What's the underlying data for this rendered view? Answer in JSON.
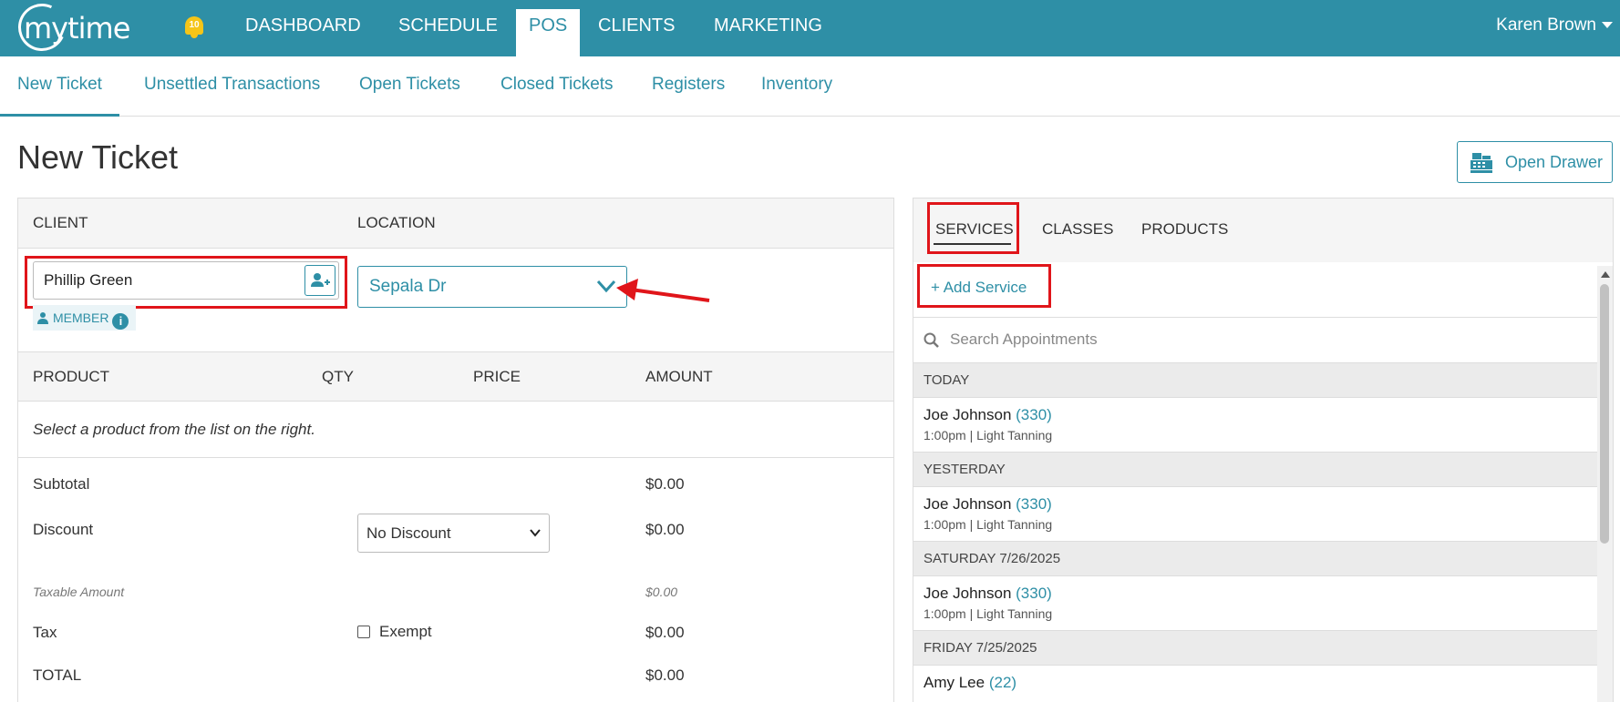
{
  "app": {
    "logo_text": "mytime",
    "notifications_count": "10",
    "user_name": "Karen Brown"
  },
  "nav": {
    "items": [
      {
        "label": "DASHBOARD"
      },
      {
        "label": "SCHEDULE"
      },
      {
        "label": "POS"
      },
      {
        "label": "CLIENTS"
      },
      {
        "label": "MARKETING"
      }
    ],
    "active": "POS"
  },
  "subnav": {
    "items": [
      {
        "label": "New Ticket"
      },
      {
        "label": "Unsettled Transactions"
      },
      {
        "label": "Open Tickets"
      },
      {
        "label": "Closed Tickets"
      },
      {
        "label": "Registers"
      },
      {
        "label": "Inventory"
      }
    ],
    "active": "New Ticket"
  },
  "page": {
    "title": "New Ticket",
    "open_drawer_label": "Open Drawer"
  },
  "ticket": {
    "headers": {
      "client": "CLIENT",
      "location": "LOCATION"
    },
    "client_value": "Phillip Green",
    "member_label": "MEMBER",
    "location_value": "Sepala Dr",
    "columns": {
      "product": "PRODUCT",
      "qty": "QTY",
      "price": "PRICE",
      "amount": "AMOUNT"
    },
    "empty_message": "Select a product from the list on the right.",
    "subtotal_label": "Subtotal",
    "subtotal_value": "$0.00",
    "discount_label": "Discount",
    "discount_option": "No Discount",
    "discount_value": "$0.00",
    "taxable_label": "Taxable Amount",
    "taxable_value": "$0.00",
    "tax_label": "Tax",
    "exempt_label": "Exempt",
    "tax_value": "$0.00",
    "total_label": "TOTAL",
    "total_value": "$0.00"
  },
  "catalog": {
    "tabs": [
      {
        "label": "SERVICES"
      },
      {
        "label": "CLASSES"
      },
      {
        "label": "PRODUCTS"
      }
    ],
    "active_tab": "SERVICES",
    "add_service_label": "+ Add Service",
    "search_placeholder": "Search Appointments",
    "groups": [
      {
        "header": "TODAY",
        "items": [
          {
            "name": "Joe Johnson",
            "code": "(330)",
            "detail": "1:00pm | Light Tanning"
          }
        ]
      },
      {
        "header": "YESTERDAY",
        "items": [
          {
            "name": "Joe Johnson",
            "code": "(330)",
            "detail": "1:00pm | Light Tanning"
          }
        ]
      },
      {
        "header": "SATURDAY 7/26/2025",
        "items": [
          {
            "name": "Joe Johnson",
            "code": "(330)",
            "detail": "1:00pm | Light Tanning"
          }
        ]
      },
      {
        "header": "FRIDAY 7/25/2025",
        "items": [
          {
            "name": "Amy Lee",
            "code": "(22)",
            "detail": ""
          }
        ]
      }
    ]
  },
  "colors": {
    "brand": "#2e8fa6",
    "annotation": "#e0151a"
  }
}
